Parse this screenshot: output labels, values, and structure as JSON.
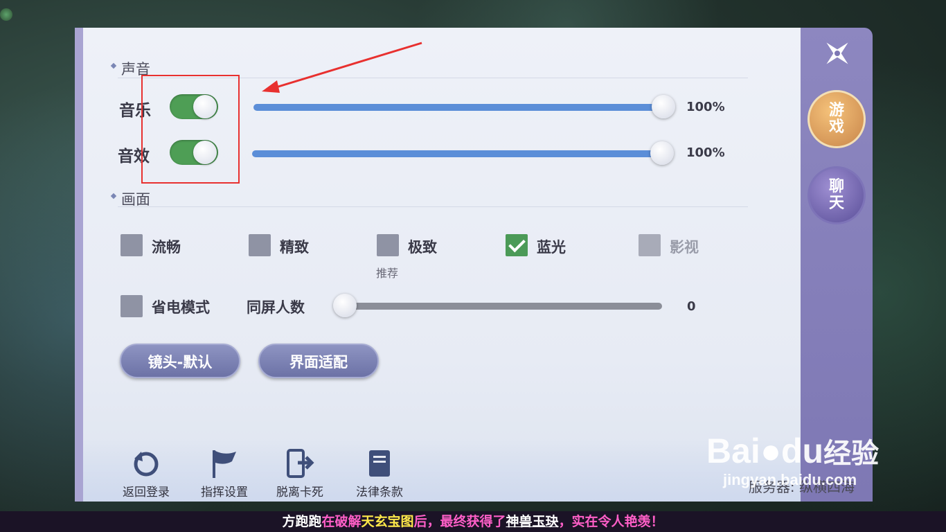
{
  "sections": {
    "sound_title": "声音",
    "display_title": "画面"
  },
  "sound": {
    "music_label": "音乐",
    "music_value": "100%",
    "sfx_label": "音效",
    "sfx_value": "100%",
    "music_level": 1.0,
    "sfx_level": 1.0
  },
  "quality": {
    "options": [
      {
        "label": "流畅",
        "checked": false,
        "disabled": false
      },
      {
        "label": "精致",
        "checked": false,
        "disabled": false
      },
      {
        "label": "极致",
        "checked": false,
        "disabled": false
      },
      {
        "label": "蓝光",
        "checked": true,
        "disabled": false
      },
      {
        "label": "影视",
        "checked": false,
        "disabled": true
      }
    ],
    "recommend_note": "推荐"
  },
  "power": {
    "label": "省电模式",
    "checked": false
  },
  "same_screen": {
    "label": "同屏人数",
    "value": "0",
    "level": 0
  },
  "buttons": {
    "camera": "镜头-默认",
    "ui_fit": "界面适配"
  },
  "bottom_bar": {
    "back_login": "返回登录",
    "command": "指挥设置",
    "unstuck": "脱离卡死",
    "legal": "法律条款",
    "server": "服务器: 纵横四海"
  },
  "rail": {
    "game": "游戏",
    "chat": "聊天"
  },
  "ticker": {
    "p1": "方跑跑",
    "p2": "在破解",
    "p3": "天玄宝图",
    "p4": "后，最终获得了",
    "p5": "神兽玉玦",
    "p6": "，实在令人艳羡！"
  },
  "watermark": {
    "main": "Bai",
    "main2": "du",
    "cn": "经验",
    "sub": "jingyan.baidu.com"
  },
  "colors": {
    "toggle_on": "#4e9e55",
    "slider_fill": "#5b8ed8",
    "annotation": "#e8302f"
  }
}
